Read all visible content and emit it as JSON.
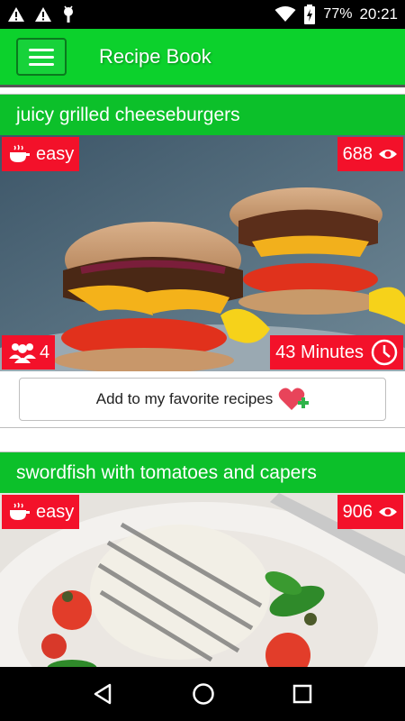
{
  "status": {
    "battery": "77%",
    "time": "20:21"
  },
  "app_bar": {
    "title": "Recipe Book"
  },
  "recipes": [
    {
      "title": "juicy grilled cheeseburgers",
      "difficulty": "easy",
      "views": "688",
      "servings": "4",
      "time": "43 Minutes",
      "fav_label": "Add to my favorite recipes"
    },
    {
      "title": "swordfish with tomatoes and capers",
      "difficulty": "easy",
      "views": "906"
    }
  ],
  "colors": {
    "primary": "#0cd12c",
    "card_header": "#0cc02a",
    "badge": "#f3112a"
  }
}
